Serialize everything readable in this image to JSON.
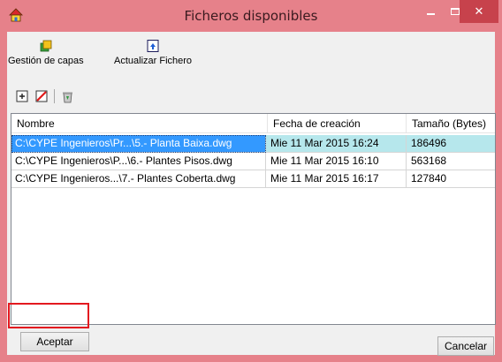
{
  "window": {
    "title": "Ficheros disponibles",
    "icon": "house-app-icon",
    "controls": {
      "minimize": "minimize-icon",
      "maximize": "maximize-icon",
      "close": "close-icon"
    },
    "accent_color": "#e6818a"
  },
  "toolbar": {
    "gestion_label": "Gestión de capas",
    "actualizar_label": "Actualizar Fichero",
    "small_tools": [
      "add-icon",
      "delete-icon",
      "recycle-bin-icon"
    ]
  },
  "table": {
    "columns": [
      "Nombre",
      "Fecha de creación",
      "Tamaño (Bytes)"
    ],
    "rows": [
      {
        "nombre": "C:\\CYPE Ingenieros\\Pr...\\5.- Planta Baixa.dwg",
        "fecha": "Mie 11 Mar 2015  16:24",
        "tamano": "186496",
        "selected": true
      },
      {
        "nombre": "C:\\CYPE Ingenieros\\P...\\6.- Plantes Pisos.dwg",
        "fecha": "Mie 11 Mar 2015  16:10",
        "tamano": "563168",
        "selected": false
      },
      {
        "nombre": "C:\\CYPE Ingenieros...\\7.- Plantes Coberta.dwg",
        "fecha": "Mie 11 Mar 2015  16:17",
        "tamano": "127840",
        "selected": false
      }
    ]
  },
  "buttons": {
    "aceptar": "Aceptar",
    "cancelar": "Cancelar"
  }
}
